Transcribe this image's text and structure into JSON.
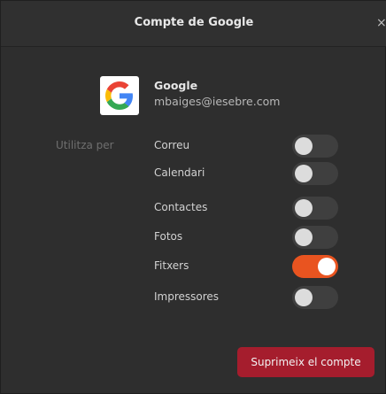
{
  "dialog": {
    "title": "Compte de Google",
    "close_glyph": "×"
  },
  "account": {
    "icon": "google-logo-icon",
    "name": "Google",
    "email": "mbaiges@iesebre.com"
  },
  "usage": {
    "label": "Utilitza per",
    "services": [
      {
        "label": "Correu",
        "enabled": false
      },
      {
        "label": "Calendari",
        "enabled": false
      },
      {
        "label": "Contactes",
        "enabled": false
      },
      {
        "label": "Fotos",
        "enabled": false
      },
      {
        "label": "Fitxers",
        "enabled": true
      },
      {
        "label": "Impressores",
        "enabled": false
      }
    ]
  },
  "actions": {
    "remove_label": "Suprimeix el compte"
  },
  "colors": {
    "accent": "#e95420",
    "destructive": "#a51d2d"
  }
}
